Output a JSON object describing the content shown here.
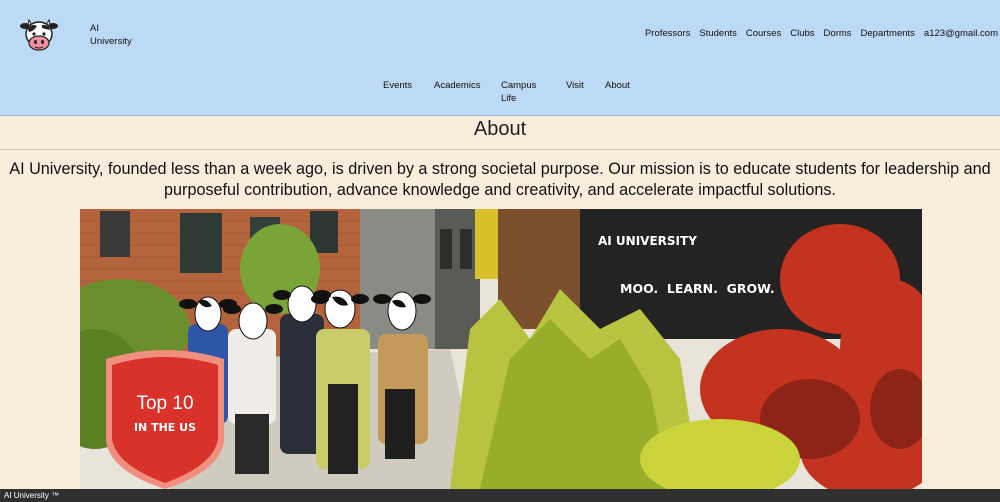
{
  "header": {
    "brand_line1": "AI",
    "brand_line2": "University",
    "nav_top": [
      "Professors",
      "Students",
      "Courses",
      "Clubs",
      "Dorms",
      "Departments",
      "a123@gmail.com"
    ],
    "nav_sub": {
      "events": "Events",
      "academics": "Academics",
      "campus_line1": "Campus",
      "campus_line2": "Life",
      "visit": "Visit",
      "about": "About"
    },
    "bg_color": "#bcd9f5"
  },
  "main": {
    "title": "About",
    "mission_line1": "AI University, founded less than a week ago, is driven by a strong societal purpose. Our mission is to educate students for leadership and",
    "mission_line2": "purposeful contribution, advance knowledge and creativity, and accelerate impactful solutions.",
    "hero": {
      "headline": "AI UNIVERSITY",
      "tagline": "MOO.  LEARN.  GROW.",
      "badge_line1": "Top 10",
      "badge_line2": "IN THE US"
    }
  },
  "footer": {
    "text": "AI University ™"
  },
  "colors": {
    "page_bg": "#f9eddc",
    "footer_bg": "#2f2f2f",
    "badge_red": "#d8322b"
  }
}
